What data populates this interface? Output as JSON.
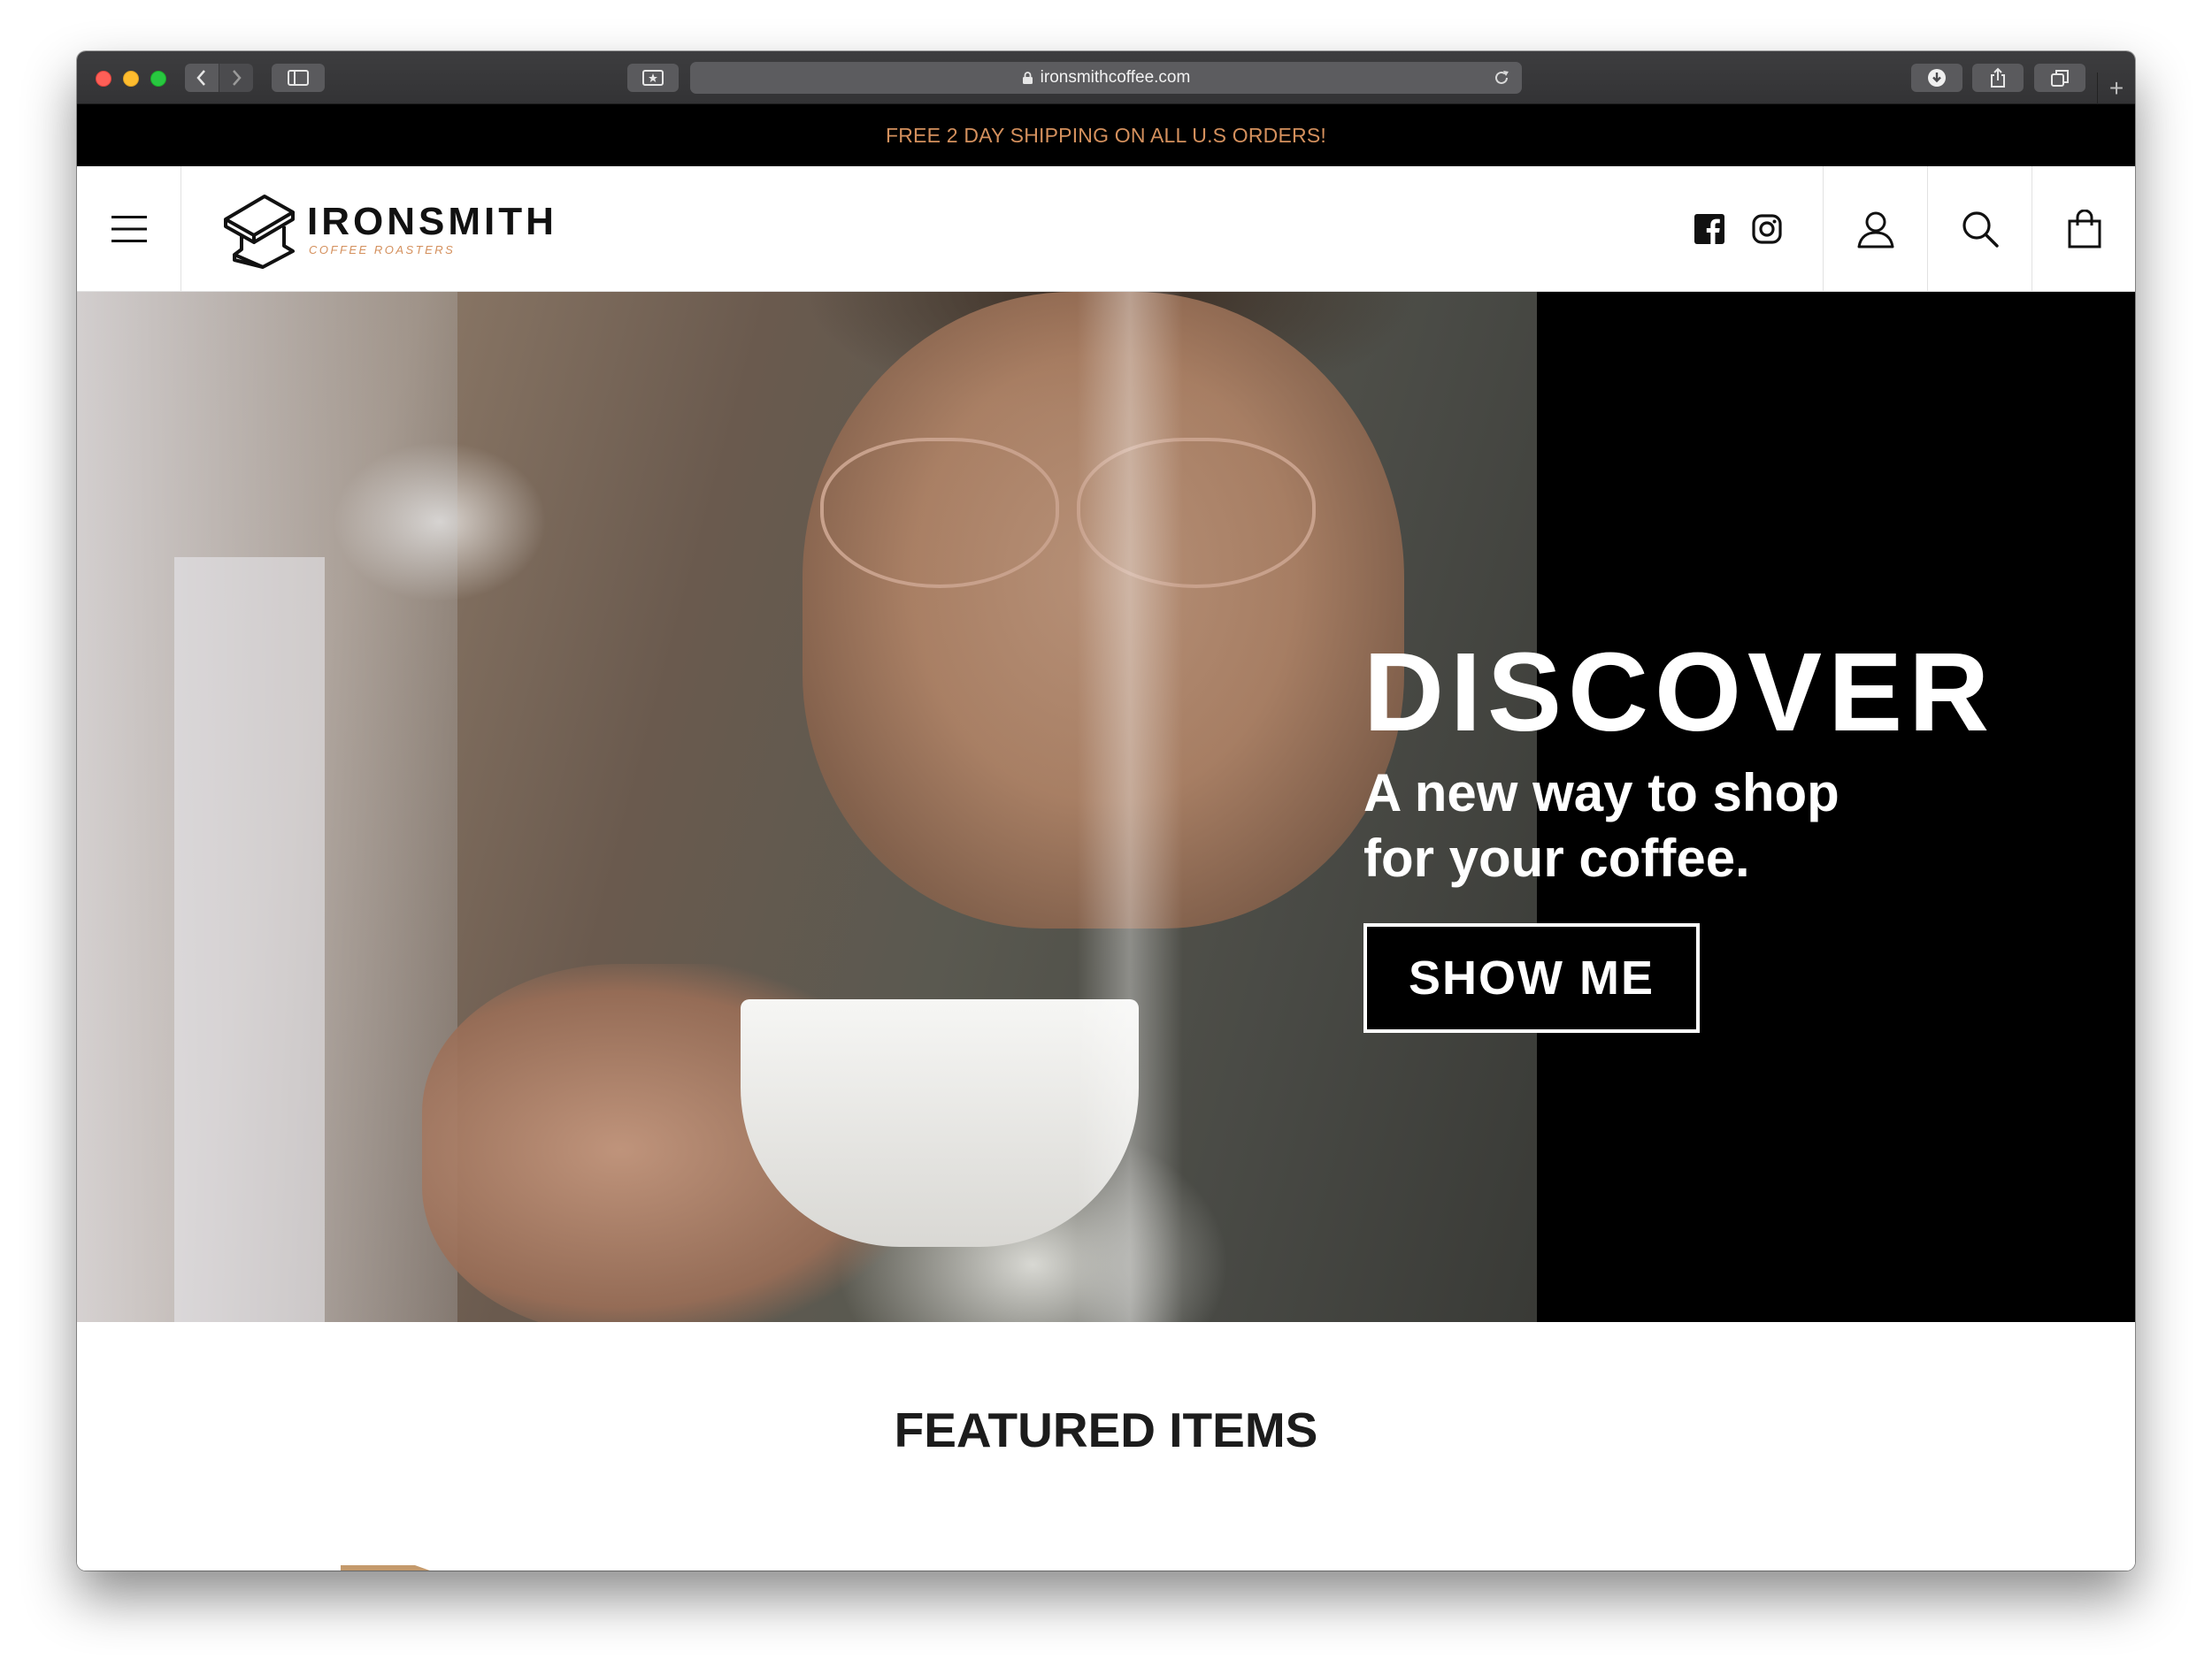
{
  "browser": {
    "url": "ironsmithcoffee.com",
    "icons": {
      "back": "chevron-left-icon",
      "forward": "chevron-right-icon",
      "sidebar": "sidebar-icon",
      "favorites": "star-icon",
      "lock": "lock-icon",
      "reload": "reload-icon",
      "downloads": "download-icon",
      "share": "share-icon",
      "tabs": "tabs-icon",
      "new_tab": "+"
    }
  },
  "promo_bar": {
    "text": "FREE 2 DAY SHIPPING ON ALL U.S ORDERS!",
    "color": "#d4905d"
  },
  "header": {
    "logo_name": "IRONSMITH",
    "logo_sub": "COFFEE ROASTERS",
    "icons": {
      "menu": "hamburger-menu-icon",
      "facebook": "facebook-icon",
      "instagram": "instagram-icon",
      "account": "user-icon",
      "search": "search-icon",
      "cart": "shopping-bag-icon"
    }
  },
  "hero": {
    "title": "DISCOVER",
    "subtitle_line1": "A new way to shop",
    "subtitle_line2": "for your coffee.",
    "button_label": "SHOW ME"
  },
  "featured": {
    "title": "FEATURED ITEMS"
  }
}
